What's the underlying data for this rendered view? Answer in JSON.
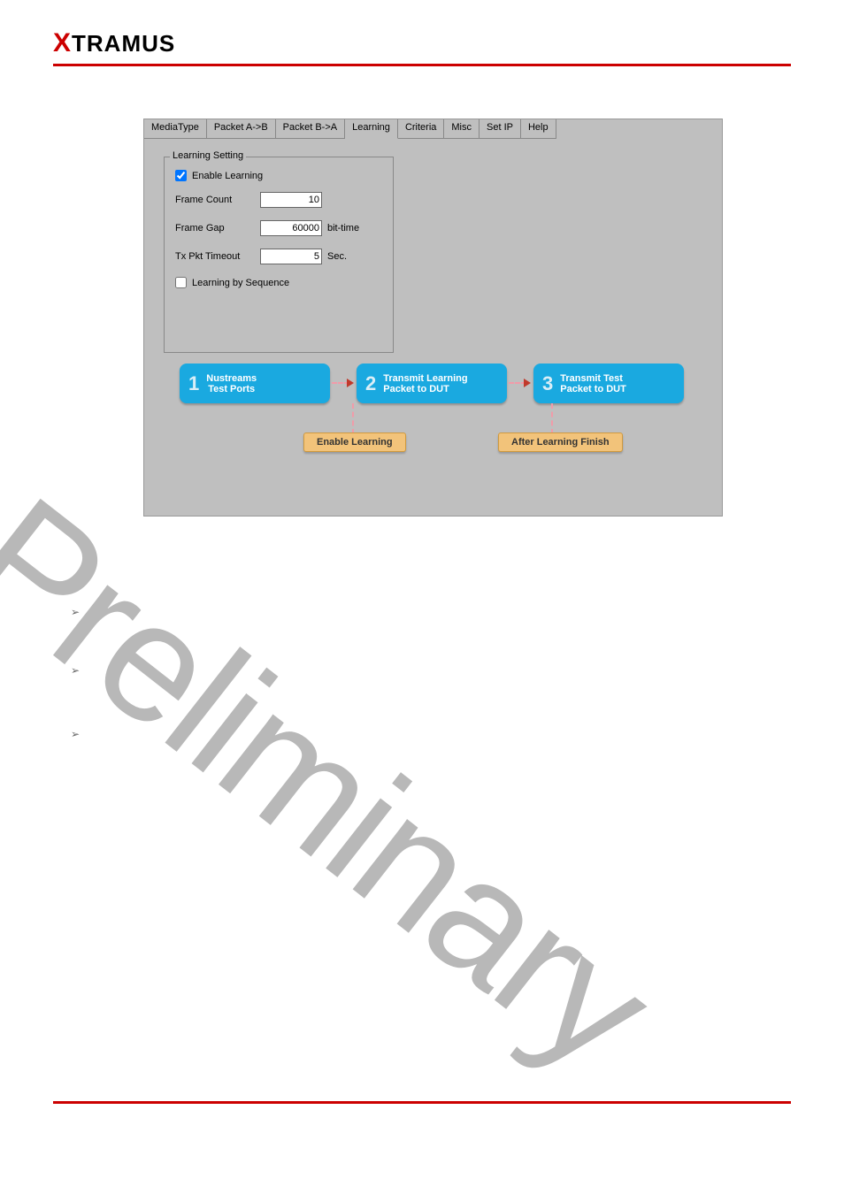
{
  "logo": {
    "x": "X",
    "rest": "TRAMUS"
  },
  "tabs": [
    "MediaType",
    "Packet A->B",
    "Packet B->A",
    "Learning",
    "Criteria",
    "Misc",
    "Set IP",
    "Help"
  ],
  "active_tab_index": 3,
  "groupbox": {
    "title": "Learning Setting",
    "enable_label": "Enable Learning",
    "enable_checked": true,
    "frame_count_label": "Frame Count",
    "frame_count_value": "10",
    "frame_gap_label": "Frame Gap",
    "frame_gap_value": "60000",
    "frame_gap_unit": "bit-time",
    "tx_timeout_label": "Tx Pkt Timeout",
    "tx_timeout_value": "5",
    "tx_timeout_unit": "Sec.",
    "seq_label": "Learning by Sequence",
    "seq_checked": false
  },
  "flow": {
    "step1_num": "1",
    "step1_txt": "Nustreams\nTest Ports",
    "step2_num": "2",
    "step2_txt": "Transmit Learning\nPacket to DUT",
    "step3_num": "3",
    "step3_txt": "Transmit Test\nPacket to DUT",
    "badge1": "Enable Learning",
    "badge2": "After Learning Finish"
  },
  "bullet_glyph": "➢",
  "watermark": "Preliminary"
}
